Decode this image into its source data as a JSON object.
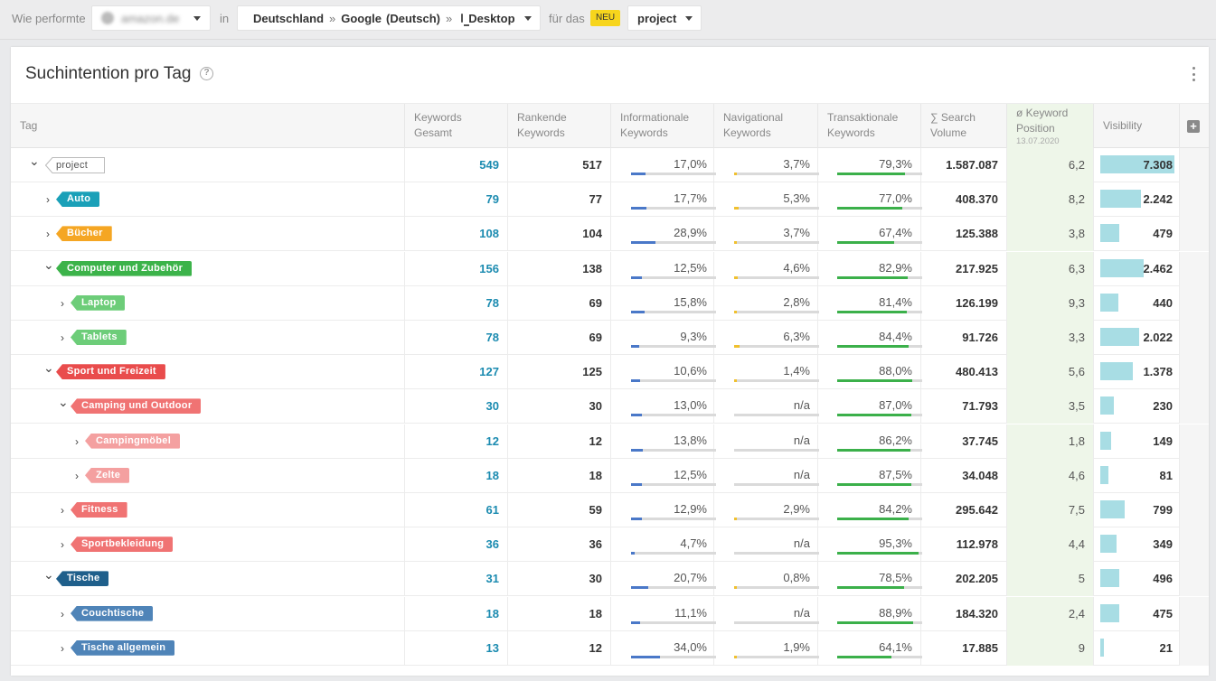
{
  "topbar": {
    "prefix": "Wie performte",
    "domain": "amazon.de",
    "in_label": "in",
    "country": "Deutschland",
    "engine": "Google",
    "language": "(Deutsch)",
    "device": "Desktop",
    "separator": "»",
    "fuer_das": "für das",
    "neu_badge": "NEU",
    "project": "project"
  },
  "card": {
    "title": "Suchintention pro Tag",
    "help_icon": "help-circle-icon",
    "menu_icon": "kebab-menu-icon"
  },
  "columns": {
    "tag": "Tag",
    "keywords_total": [
      "Keywords",
      "Gesamt"
    ],
    "ranking_keywords": [
      "Rankende",
      "Keywords"
    ],
    "informational": [
      "Informationale",
      "Keywords"
    ],
    "navigational": [
      "Navigational",
      "Keywords"
    ],
    "transactional": [
      "Transaktionale",
      "Keywords"
    ],
    "search_volume": [
      "∑ Search",
      "Volume"
    ],
    "keyword_position": [
      "ø Keyword",
      "Position"
    ],
    "keyword_position_date": "13.07.2020",
    "visibility": "Visibility",
    "add_column_icon": "+"
  },
  "colors": {
    "informational": "#4a78c8",
    "navigational": "#f0c02d",
    "transactional": "#3bb04a",
    "visibility": "#a8dde4",
    "keyword_link": "#1b8bb0"
  },
  "rows": [
    {
      "tag": "project",
      "level": 0,
      "expanded": true,
      "color": "",
      "kw": "549",
      "rank": "517",
      "info": "17,0%",
      "info_v": 17.0,
      "nav": "3,7%",
      "nav_v": 3.7,
      "trans": "79,3%",
      "trans_v": 79.3,
      "sv": "1.587.087",
      "pos": "6,2",
      "vis": "7.308",
      "vis_v": 7308
    },
    {
      "tag": "Auto",
      "level": 1,
      "expanded": false,
      "color": "#1aa0b8",
      "kw": "79",
      "rank": "77",
      "info": "17,7%",
      "info_v": 17.7,
      "nav": "5,3%",
      "nav_v": 5.3,
      "trans": "77,0%",
      "trans_v": 77.0,
      "sv": "408.370",
      "pos": "8,2",
      "vis": "2.242",
      "vis_v": 2242
    },
    {
      "tag": "Bücher",
      "level": 1,
      "expanded": false,
      "color": "#f5a623",
      "kw": "108",
      "rank": "104",
      "info": "28,9%",
      "info_v": 28.9,
      "nav": "3,7%",
      "nav_v": 3.7,
      "trans": "67,4%",
      "trans_v": 67.4,
      "sv": "125.388",
      "pos": "3,8",
      "vis": "479",
      "vis_v": 479
    },
    {
      "tag": "Computer und Zubehör",
      "level": 1,
      "expanded": true,
      "color": "#3cb34a",
      "kw": "156",
      "rank": "138",
      "info": "12,5%",
      "info_v": 12.5,
      "nav": "4,6%",
      "nav_v": 4.6,
      "trans": "82,9%",
      "trans_v": 82.9,
      "sv": "217.925",
      "pos": "6,3",
      "vis": "2.462",
      "vis_v": 2462
    },
    {
      "tag": "Laptop",
      "level": 2,
      "expanded": false,
      "color": "#6dcd79",
      "kw": "78",
      "rank": "69",
      "info": "15,8%",
      "info_v": 15.8,
      "nav": "2,8%",
      "nav_v": 2.8,
      "trans": "81,4%",
      "trans_v": 81.4,
      "sv": "126.199",
      "pos": "9,3",
      "vis": "440",
      "vis_v": 440
    },
    {
      "tag": "Tablets",
      "level": 2,
      "expanded": false,
      "color": "#6dcd79",
      "kw": "78",
      "rank": "69",
      "info": "9,3%",
      "info_v": 9.3,
      "nav": "6,3%",
      "nav_v": 6.3,
      "trans": "84,4%",
      "trans_v": 84.4,
      "sv": "91.726",
      "pos": "3,3",
      "vis": "2.022",
      "vis_v": 2022
    },
    {
      "tag": "Sport und Freizeit",
      "level": 1,
      "expanded": true,
      "color": "#e94c4c",
      "kw": "127",
      "rank": "125",
      "info": "10,6%",
      "info_v": 10.6,
      "nav": "1,4%",
      "nav_v": 1.4,
      "trans": "88,0%",
      "trans_v": 88.0,
      "sv": "480.413",
      "pos": "5,6",
      "vis": "1.378",
      "vis_v": 1378
    },
    {
      "tag": "Camping und Outdoor",
      "level": 2,
      "expanded": true,
      "color": "#f07373",
      "kw": "30",
      "rank": "30",
      "info": "13,0%",
      "info_v": 13.0,
      "nav": "n/a",
      "nav_v": 0,
      "trans": "87,0%",
      "trans_v": 87.0,
      "sv": "71.793",
      "pos": "3,5",
      "vis": "230",
      "vis_v": 230
    },
    {
      "tag": "Campingmöbel",
      "level": 3,
      "expanded": false,
      "color": "#f4a0a0",
      "kw": "12",
      "rank": "12",
      "info": "13,8%",
      "info_v": 13.8,
      "nav": "n/a",
      "nav_v": 0,
      "trans": "86,2%",
      "trans_v": 86.2,
      "sv": "37.745",
      "pos": "1,8",
      "vis": "149",
      "vis_v": 149
    },
    {
      "tag": "Zelte",
      "level": 3,
      "expanded": false,
      "color": "#f4a0a0",
      "kw": "18",
      "rank": "18",
      "info": "12,5%",
      "info_v": 12.5,
      "nav": "n/a",
      "nav_v": 0,
      "trans": "87,5%",
      "trans_v": 87.5,
      "sv": "34.048",
      "pos": "4,6",
      "vis": "81",
      "vis_v": 81
    },
    {
      "tag": "Fitness",
      "level": 2,
      "expanded": false,
      "color": "#f07373",
      "kw": "61",
      "rank": "59",
      "info": "12,9%",
      "info_v": 12.9,
      "nav": "2,9%",
      "nav_v": 2.9,
      "trans": "84,2%",
      "trans_v": 84.2,
      "sv": "295.642",
      "pos": "7,5",
      "vis": "799",
      "vis_v": 799
    },
    {
      "tag": "Sportbekleidung",
      "level": 2,
      "expanded": false,
      "color": "#f07373",
      "kw": "36",
      "rank": "36",
      "info": "4,7%",
      "info_v": 4.7,
      "nav": "n/a",
      "nav_v": 0,
      "trans": "95,3%",
      "trans_v": 95.3,
      "sv": "112.978",
      "pos": "4,4",
      "vis": "349",
      "vis_v": 349
    },
    {
      "tag": "Tische",
      "level": 1,
      "expanded": true,
      "color": "#1f5f8b",
      "kw": "31",
      "rank": "30",
      "info": "20,7%",
      "info_v": 20.7,
      "nav": "0,8%",
      "nav_v": 0.8,
      "trans": "78,5%",
      "trans_v": 78.5,
      "sv": "202.205",
      "pos": "5",
      "vis": "496",
      "vis_v": 496
    },
    {
      "tag": "Couchtische",
      "level": 2,
      "expanded": false,
      "color": "#4f84b8",
      "kw": "18",
      "rank": "18",
      "info": "11,1%",
      "info_v": 11.1,
      "nav": "n/a",
      "nav_v": 0,
      "trans": "88,9%",
      "trans_v": 88.9,
      "sv": "184.320",
      "pos": "2,4",
      "vis": "475",
      "vis_v": 475
    },
    {
      "tag": "Tische allgemein",
      "level": 2,
      "expanded": false,
      "color": "#4f84b8",
      "kw": "13",
      "rank": "12",
      "info": "34,0%",
      "info_v": 34.0,
      "nav": "1,9%",
      "nav_v": 1.9,
      "trans": "64,1%",
      "trans_v": 64.1,
      "sv": "17.885",
      "pos": "9",
      "vis": "21",
      "vis_v": 21
    }
  ]
}
